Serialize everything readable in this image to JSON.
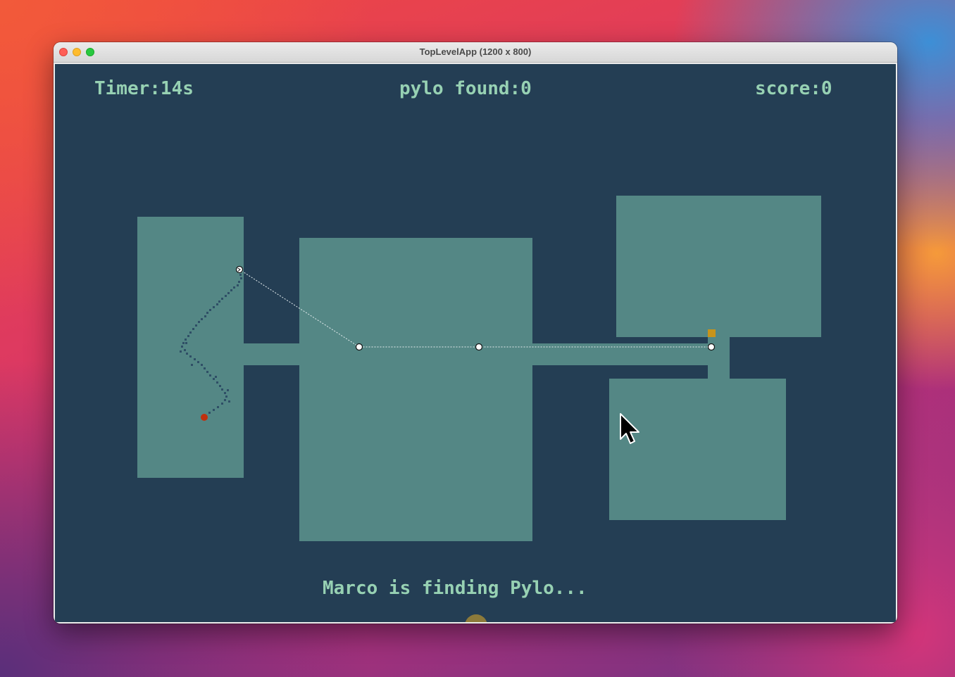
{
  "window": {
    "title": "TopLevelApp (1200 x 800)"
  },
  "hud": {
    "timer": "Timer:14s",
    "found": "pylo found:0",
    "score": "score:0"
  },
  "status_message": "Marco is finding Pylo...",
  "colors": {
    "background": "#243e54",
    "room": "#548785",
    "hud_text": "#97d1b3",
    "trail": "#2f4f66",
    "player_dot": "#c0300f",
    "target_marker": "#c8941a",
    "waypoint": "#ffffff"
  },
  "icons": {
    "cursor": "arrow-cursor-icon",
    "player": "red-dot-icon",
    "target": "orange-square-icon"
  }
}
